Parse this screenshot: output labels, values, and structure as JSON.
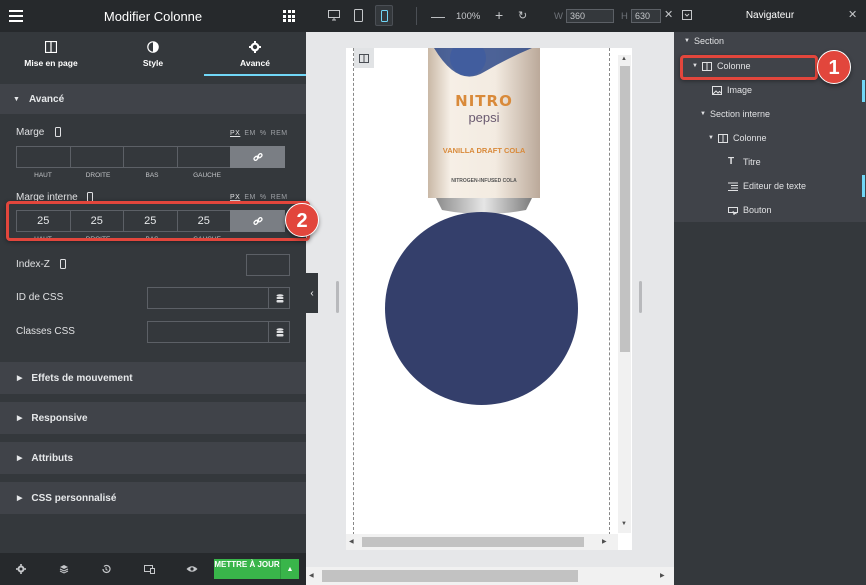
{
  "panel": {
    "title": "Modifier Colonne",
    "tabs": [
      {
        "label": "Mise en page",
        "icon": "layout-icon"
      },
      {
        "label": "Style",
        "icon": "contrast-icon"
      },
      {
        "label": "Avancé",
        "icon": "gear-icon",
        "active": true
      }
    ],
    "section_title": "Avancé",
    "margin": {
      "label": "Marge",
      "units": [
        "PX",
        "EM",
        "%",
        "REM"
      ],
      "active_unit": "PX",
      "values": [
        "",
        "",
        "",
        ""
      ],
      "sides": [
        "HAUT",
        "DROITE",
        "BAS",
        "GAUCHE"
      ]
    },
    "padding": {
      "label": "Marge interne",
      "units": [
        "PX",
        "EM",
        "%",
        "REM"
      ],
      "active_unit": "PX",
      "values": [
        "25",
        "25",
        "25",
        "25"
      ],
      "sides": [
        "HAUT",
        "DROITE",
        "BAS",
        "GAUCHE"
      ]
    },
    "zindex_label": "Index-Z",
    "css_id_label": "ID de CSS",
    "css_classes_label": "Classes CSS",
    "collapsed_sections": [
      "Effets de mouvement",
      "Responsive",
      "Attributs",
      "CSS personnalisé"
    ],
    "update_button": "METTRE À JOUR"
  },
  "toolbar": {
    "zoom": "100%",
    "width_label": "W",
    "width_value": "360",
    "height_label": "H",
    "height_value": "630"
  },
  "preview": {
    "can_brand": "NITRO",
    "can_sub": "pepsi",
    "can_flavor": "VANILLA DRAFT COLA",
    "can_note": "NITROGEN-INFUSED COLA",
    "circle_color": "#343f6b"
  },
  "navigator": {
    "title": "Navigateur",
    "items": [
      {
        "label": "Section",
        "level": 0
      },
      {
        "label": "Colonne",
        "level": 1,
        "selected": true
      },
      {
        "label": "Image",
        "level": 2
      },
      {
        "label": "Section interne",
        "level": 1
      },
      {
        "label": "Colonne",
        "level": 2
      },
      {
        "label": "Titre",
        "level": 3
      },
      {
        "label": "Editeur de texte",
        "level": 3
      },
      {
        "label": "Bouton",
        "level": 3
      }
    ]
  },
  "annotations": [
    {
      "number": "1"
    },
    {
      "number": "2"
    }
  ],
  "colors": {
    "accent": "#71d7f7",
    "annotation": "#e2463c",
    "update": "#39b54a"
  }
}
